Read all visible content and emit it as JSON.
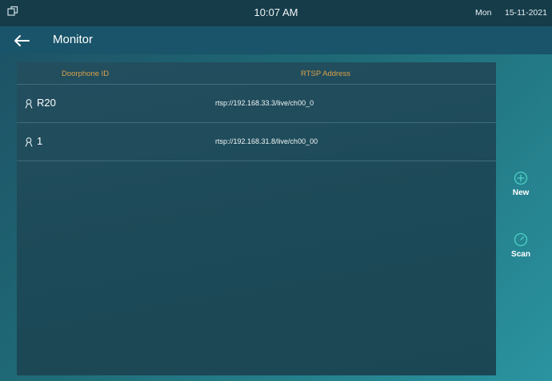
{
  "status_bar": {
    "time": "10:07 AM",
    "day": "Mon",
    "date": "15-11-2021"
  },
  "header": {
    "title": "Monitor"
  },
  "table": {
    "columns": [
      "Doorphone ID",
      "RTSP Address"
    ],
    "rows": [
      {
        "id": "R20",
        "rtsp": "rtsp://192.168.33.3/live/ch00_0"
      },
      {
        "id": "1",
        "rtsp": "rtsp://192.168.31.8/live/ch00_00"
      }
    ]
  },
  "actions": {
    "new_label": "New",
    "scan_label": "Scan"
  },
  "colors": {
    "header_text": "#d9a24a",
    "accent_icon": "#4fd1c5",
    "status_bar": "#163c4a",
    "title_bar": "#19546a"
  },
  "icons": {
    "window": "window-icon",
    "back": "back-arrow-icon",
    "contact": "person-icon",
    "new": "plus-circle-icon",
    "scan": "gauge-icon"
  }
}
